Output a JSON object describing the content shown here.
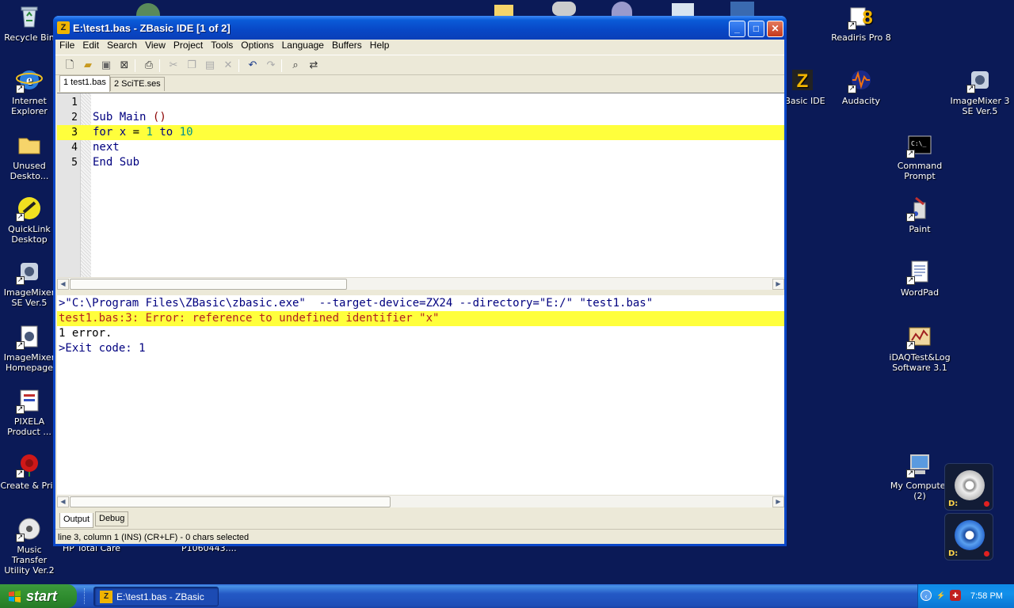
{
  "desktop": {
    "left_icons": [
      {
        "label": "Recycle Bin",
        "icon": "recycle-bin-icon"
      },
      {
        "label": "Internet Explorer",
        "icon": "internet-explorer-icon"
      },
      {
        "label": "Unused Deskto...",
        "icon": "folder-icon"
      },
      {
        "label": "QuickLink Desktop",
        "icon": "quicklink-icon"
      },
      {
        "label": "ImageMixer SE Ver.5",
        "icon": "imagemixer-icon"
      },
      {
        "label": "ImageMixer Homepage",
        "icon": "imagemixer-homepage-icon"
      },
      {
        "label": "PIXELA Product ...",
        "icon": "pixela-icon"
      },
      {
        "label": "Create & Prin",
        "icon": "rose-icon"
      },
      {
        "label": "Music Transfer Utility Ver.2",
        "icon": "music-transfer-icon"
      }
    ],
    "bottom_partial_labels": [
      "HP Total Care",
      "P1060443...."
    ],
    "right_icons": [
      {
        "label": "Readiris Pro 8",
        "icon": "readiris-icon"
      },
      {
        "label": "Basic IDE",
        "icon": "zbasic-icon"
      },
      {
        "label": "Audacity",
        "icon": "audacity-icon"
      },
      {
        "label": "ImageMixer 3 SE Ver.5",
        "icon": "imagemixer3-icon"
      },
      {
        "label": "Command Prompt",
        "icon": "command-prompt-icon"
      },
      {
        "label": "Paint",
        "icon": "paint-icon"
      },
      {
        "label": "WordPad",
        "icon": "wordpad-icon"
      },
      {
        "label": "iDAQTest&Log Software 3.1",
        "icon": "idaq-icon"
      },
      {
        "label": "My Computer (2)",
        "icon": "my-computer-icon"
      }
    ],
    "drives": [
      {
        "label": "D:"
      },
      {
        "label": "D:"
      }
    ]
  },
  "window": {
    "title": "E:\\test1.bas - ZBasic IDE [1 of 2]",
    "app_icon_letter": "Z",
    "menu": [
      "File",
      "Edit",
      "Search",
      "View",
      "Project",
      "Tools",
      "Options",
      "Language",
      "Buffers",
      "Help"
    ],
    "toolbar_icons": [
      "new-file-icon",
      "open-file-icon",
      "save-icon",
      "close-file-icon",
      "print-icon",
      "cut-icon",
      "copy-icon",
      "paste-icon",
      "delete-icon",
      "undo-icon",
      "redo-icon",
      "find-icon",
      "replace-icon"
    ],
    "tabs": [
      "1 test1.bas",
      "2 SciTE.ses"
    ],
    "active_tab": 0,
    "editor_lines": [
      {
        "num": "1",
        "code": ""
      },
      {
        "num": "2",
        "code": "Sub Main ()"
      },
      {
        "num": "3",
        "code": "for x = 1 to 10",
        "highlighted": true
      },
      {
        "num": "4",
        "code": "next"
      },
      {
        "num": "5",
        "code": "End Sub"
      }
    ],
    "output_lines": [
      {
        "text": ">\"C:\\Program Files\\ZBasic\\zbasic.exe\"  --target-device=ZX24 --directory=\"E:/\" \"test1.bas\"",
        "kind": "cmd"
      },
      {
        "text": "test1.bas:3: Error: reference to undefined identifier \"x\"",
        "kind": "err"
      },
      {
        "text": "1 error.",
        "kind": "plain"
      },
      {
        "text": ">Exit code: 1",
        "kind": "exit"
      }
    ],
    "output_tabs": [
      "Output",
      "Debug"
    ],
    "status": "line 3, column 1 (INS) (CR+LF)  -  0 chars selected"
  },
  "taskbar": {
    "start_label": "start",
    "task_label": "E:\\test1.bas - ZBasic ...",
    "clock": "7:58 PM"
  },
  "colors": {
    "desktop_bg": "#0b1a57",
    "highlight": "#ffff3c",
    "keyword": "#00007f",
    "number": "#009090",
    "error_text": "#b22222"
  }
}
